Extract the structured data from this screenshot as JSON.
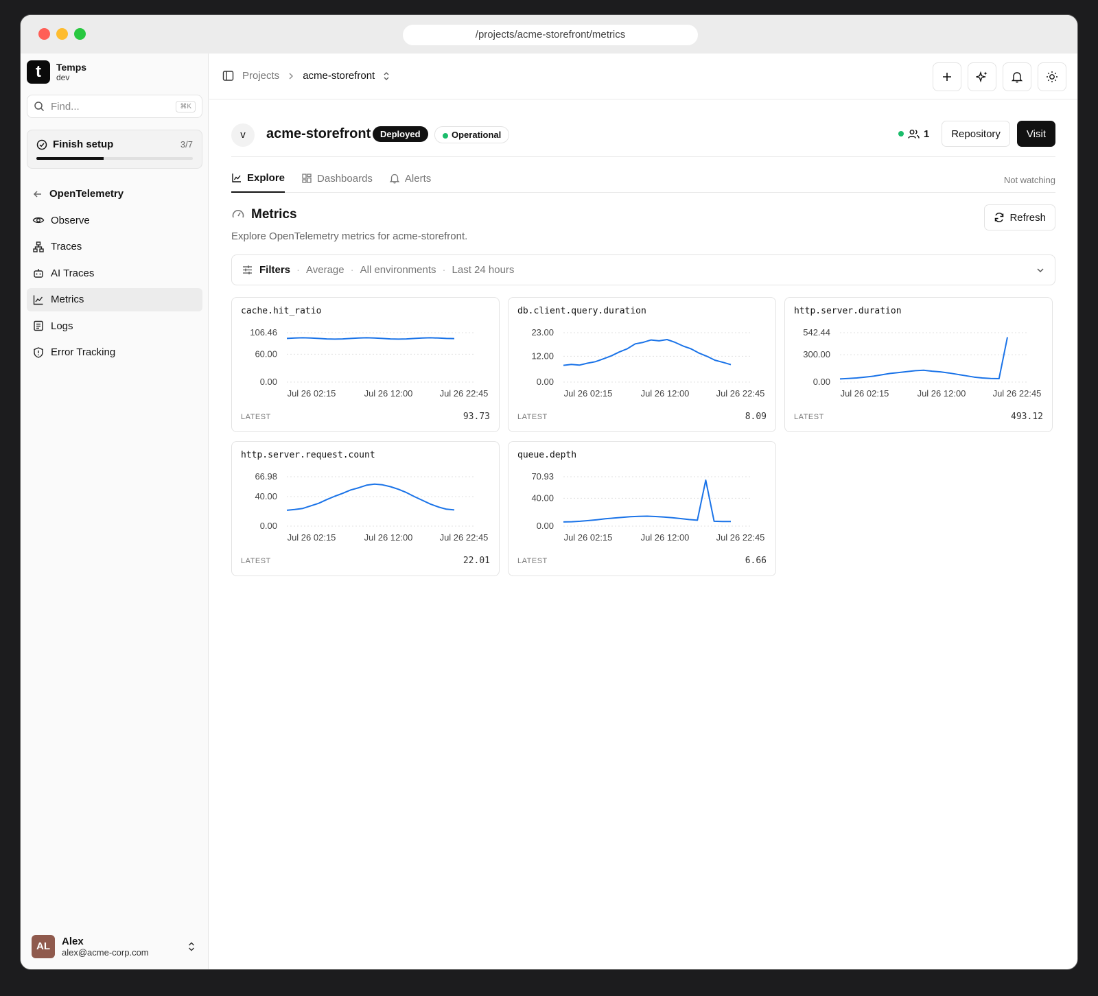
{
  "browser": {
    "url": "/projects/acme-storefront/metrics"
  },
  "sidebar": {
    "brand_logo": "t",
    "brand_name": "Temps",
    "brand_env": "dev",
    "search_placeholder": "Find...",
    "search_shortcut": "⌘K",
    "setup": {
      "label": "Finish setup",
      "count": "3/7",
      "progress": 0.43
    },
    "section": "OpenTelemetry",
    "items": [
      {
        "label": "Observe",
        "icon": "eye-icon"
      },
      {
        "label": "Traces",
        "icon": "trace-tree-icon"
      },
      {
        "label": "AI Traces",
        "icon": "robot-icon"
      },
      {
        "label": "Metrics",
        "icon": "line-chart-icon",
        "active": true
      },
      {
        "label": "Logs",
        "icon": "logs-icon"
      },
      {
        "label": "Error Tracking",
        "icon": "shield-alert-icon"
      }
    ],
    "user": {
      "initials": "AL",
      "name": "Alex",
      "email": "alex@acme-corp.com"
    }
  },
  "topbar": {
    "crumb_root": "Projects",
    "crumb_current": "acme-storefront"
  },
  "project": {
    "avatar": "v",
    "name": "acme-storefront",
    "status_badge": "Deployed",
    "health_badge": "Operational",
    "viewers": "1",
    "repository_label": "Repository",
    "visit_label": "Visit"
  },
  "tabs": [
    {
      "label": "Explore",
      "active": true
    },
    {
      "label": "Dashboards"
    },
    {
      "label": "Alerts"
    }
  ],
  "watch_status": "Not watching",
  "metrics": {
    "title": "Metrics",
    "subtitle": "Explore OpenTelemetry metrics for acme-storefront.",
    "refresh_label": "Refresh",
    "filters": {
      "label": "Filters",
      "aggregation": "Average",
      "environment": "All environments",
      "range": "Last 24 hours"
    },
    "latest_label": "LATEST"
  },
  "colors": {
    "line": "#1a73e8",
    "grid": "#e0e0e0"
  },
  "chart_data": [
    {
      "type": "line",
      "title": "cache.hit_ratio",
      "x_ticks": [
        "Jul 26 02:15",
        "Jul 26 12:00",
        "Jul 26 22:45"
      ],
      "y_ticks": [
        "106.46",
        "60.00",
        "0.00"
      ],
      "ylim": [
        0,
        106.46
      ],
      "latest": "93.73",
      "values": [
        94,
        95,
        95.5,
        95,
        94,
        93,
        92.5,
        93,
        94,
        95,
        95.5,
        95,
        94,
        93,
        92.5,
        93,
        94,
        95,
        95.5,
        95,
        94,
        93.7
      ]
    },
    {
      "type": "line",
      "title": "db.client.query.duration",
      "x_ticks": [
        "Jul 26 02:15",
        "Jul 26 12:00",
        "Jul 26 22:45"
      ],
      "y_ticks": [
        "23.00",
        "12.00",
        "0.00"
      ],
      "ylim": [
        0,
        23
      ],
      "latest": "8.09",
      "values": [
        7.8,
        8.2,
        7.9,
        8.8,
        9.5,
        10.8,
        12.2,
        14,
        15.5,
        17.8,
        18.5,
        19.6,
        19.2,
        19.8,
        18.5,
        16.8,
        15.5,
        13.5,
        12,
        10.2,
        9.2,
        8.1
      ]
    },
    {
      "type": "line",
      "title": "http.server.duration",
      "x_ticks": [
        "Jul 26 02:15",
        "Jul 26 12:00",
        "Jul 26 22:45"
      ],
      "y_ticks": [
        "542.44",
        "300.00",
        "0.00"
      ],
      "ylim": [
        0,
        542.44
      ],
      "latest": "493.12",
      "values": [
        35,
        40,
        45,
        55,
        65,
        80,
        95,
        105,
        115,
        125,
        130,
        120,
        112,
        100,
        85,
        70,
        55,
        45,
        40,
        38,
        493
      ]
    },
    {
      "type": "line",
      "title": "http.server.request.count",
      "x_ticks": [
        "Jul 26 02:15",
        "Jul 26 12:00",
        "Jul 26 22:45"
      ],
      "y_ticks": [
        "66.98",
        "40.00",
        "0.00"
      ],
      "ylim": [
        0,
        66.98
      ],
      "latest": "22.01",
      "values": [
        21.5,
        22.5,
        24,
        27.5,
        31,
        36,
        40.5,
        44.5,
        49,
        52,
        55.5,
        57,
        56,
        53.5,
        50,
        45.5,
        40,
        35,
        30,
        26,
        23,
        22
      ]
    },
    {
      "type": "line",
      "title": "queue.depth",
      "x_ticks": [
        "Jul 26 02:15",
        "Jul 26 12:00",
        "Jul 26 22:45"
      ],
      "y_ticks": [
        "70.93",
        "40.00",
        "0.00"
      ],
      "ylim": [
        0,
        70.93
      ],
      "latest": "6.66",
      "values": [
        6,
        6.3,
        7,
        8,
        9.2,
        10.5,
        11.5,
        12.5,
        13.5,
        14,
        14.3,
        13.8,
        13,
        12,
        10.8,
        9.5,
        8.5,
        66,
        7,
        6.7,
        6.66
      ]
    }
  ]
}
